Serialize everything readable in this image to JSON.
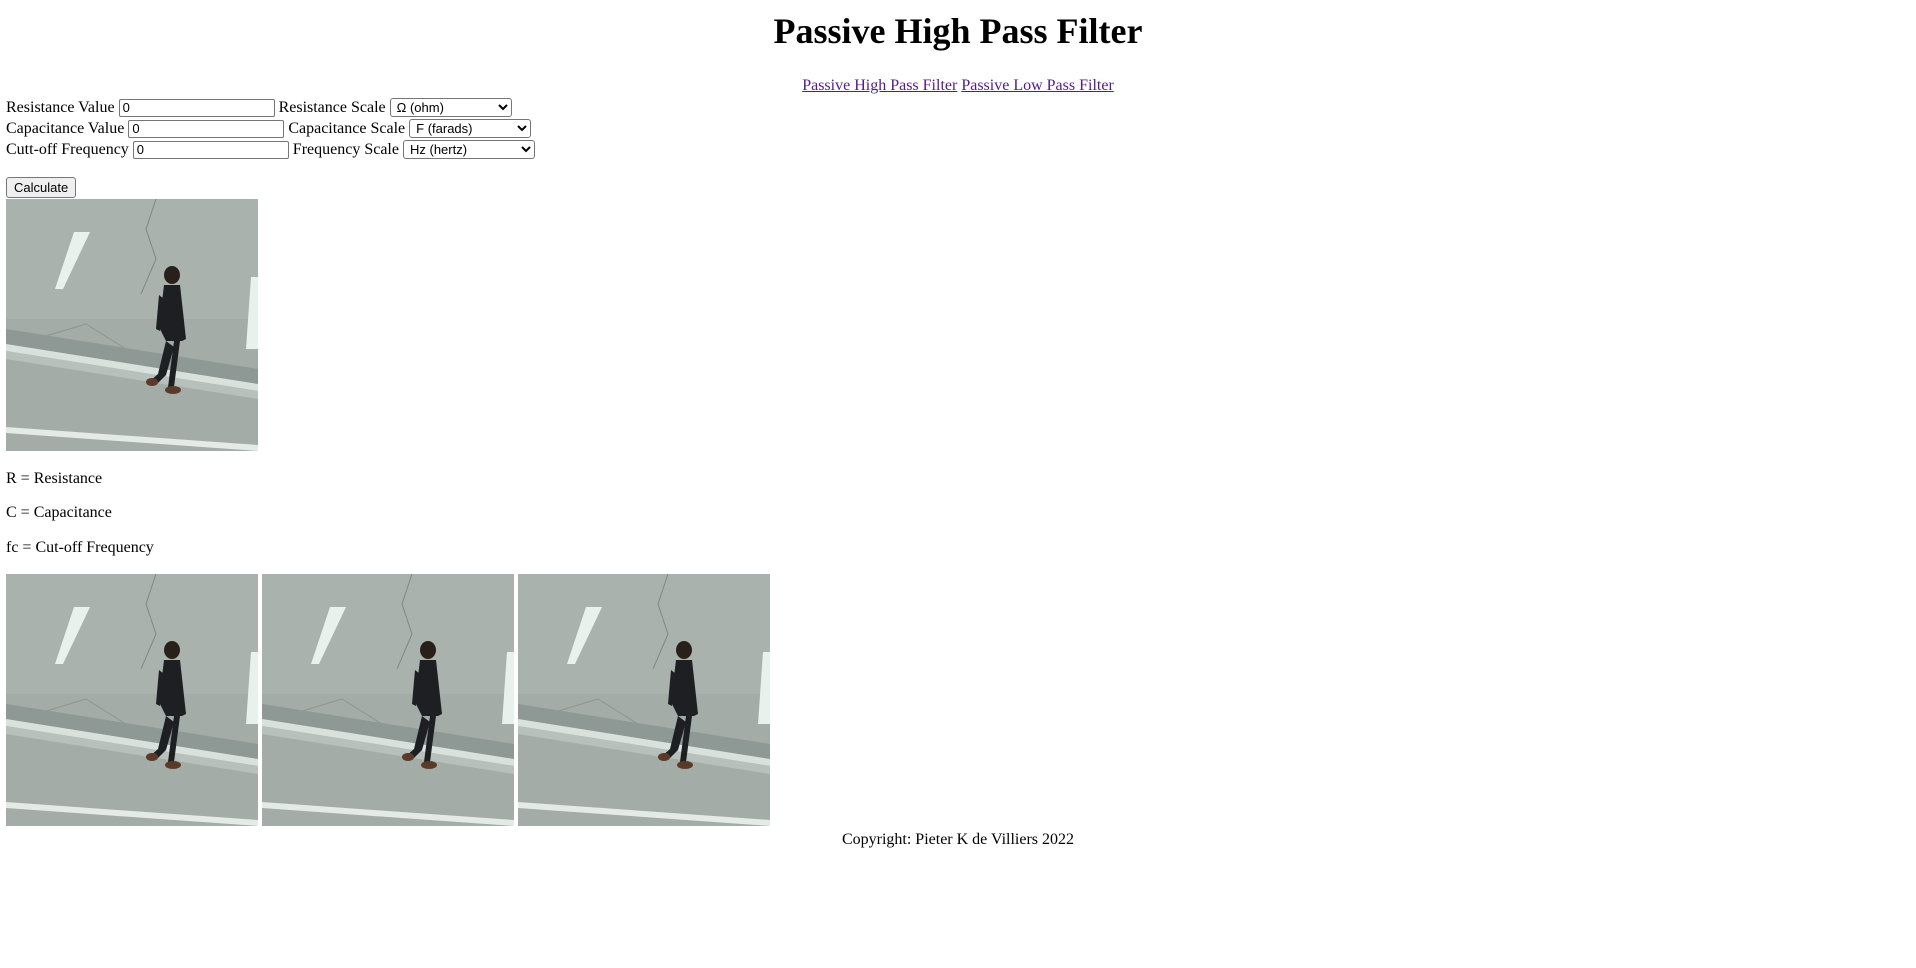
{
  "page": {
    "title": "Passive High Pass Filter"
  },
  "nav": {
    "high_pass": "Passive High Pass Filter",
    "low_pass": "Passive Low Pass Filter"
  },
  "form": {
    "resistance": {
      "label": "Resistance Value",
      "value": "0",
      "scale_label": "Resistance Scale",
      "scale_selected": "Ω (ohm)"
    },
    "capacitance": {
      "label": "Capacitance Value",
      "value": "0",
      "scale_label": "Capacitance Scale",
      "scale_selected": "F (farads)"
    },
    "frequency": {
      "label": "Cutt-off Frequency",
      "value": "0",
      "scale_label": "Frequency Scale",
      "scale_selected": "Hz (hertz)"
    },
    "calculate_label": "Calculate"
  },
  "legend": {
    "r": "R = Resistance",
    "c": "C = Capacitance",
    "fc": "fc = Cut-off Frequency"
  },
  "images": {
    "icon": "photo-man-walking-on-road"
  },
  "footer": {
    "copyright": "Copyright: Pieter K de Villiers 2022"
  },
  "colors": {
    "link_visited": "#551a8b",
    "road": "#9aa5a0"
  }
}
